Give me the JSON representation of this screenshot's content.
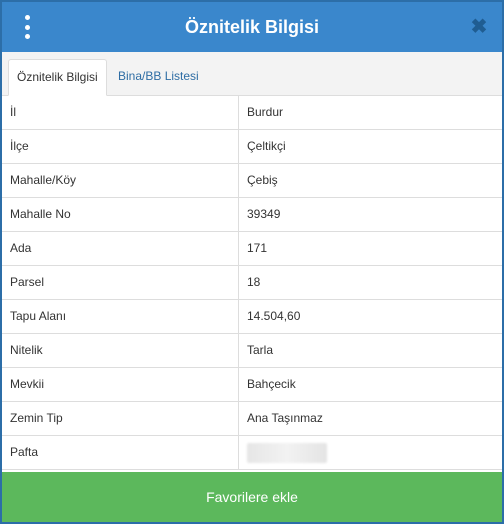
{
  "header": {
    "title": "Öznitelik Bilgisi",
    "close_symbol": "✖",
    "menu_icon": "kebab-menu-icon"
  },
  "tabs": [
    {
      "label": "Öznitelik Bilgisi",
      "active": true
    },
    {
      "label": "Bina/BB Listesi",
      "active": false
    }
  ],
  "rows": [
    {
      "key": "İl",
      "value": "Burdur"
    },
    {
      "key": "İlçe",
      "value": "Çeltikçi"
    },
    {
      "key": "Mahalle/Köy",
      "value": "Çebiş"
    },
    {
      "key": "Mahalle No",
      "value": "39349"
    },
    {
      "key": "Ada",
      "value": "171"
    },
    {
      "key": "Parsel",
      "value": "18"
    },
    {
      "key": "Tapu Alanı",
      "value": "14.504,60"
    },
    {
      "key": "Nitelik",
      "value": "Tarla"
    },
    {
      "key": "Mevkii",
      "value": "Bahçecik"
    },
    {
      "key": "Zemin Tip",
      "value": "Ana Taşınmaz"
    },
    {
      "key": "Pafta",
      "value": null
    }
  ],
  "footer": {
    "favorite_label": "Favorilere ekle"
  },
  "colors": {
    "header": "#3a87cc",
    "button": "#5cb85c",
    "link": "#2e6da4"
  }
}
